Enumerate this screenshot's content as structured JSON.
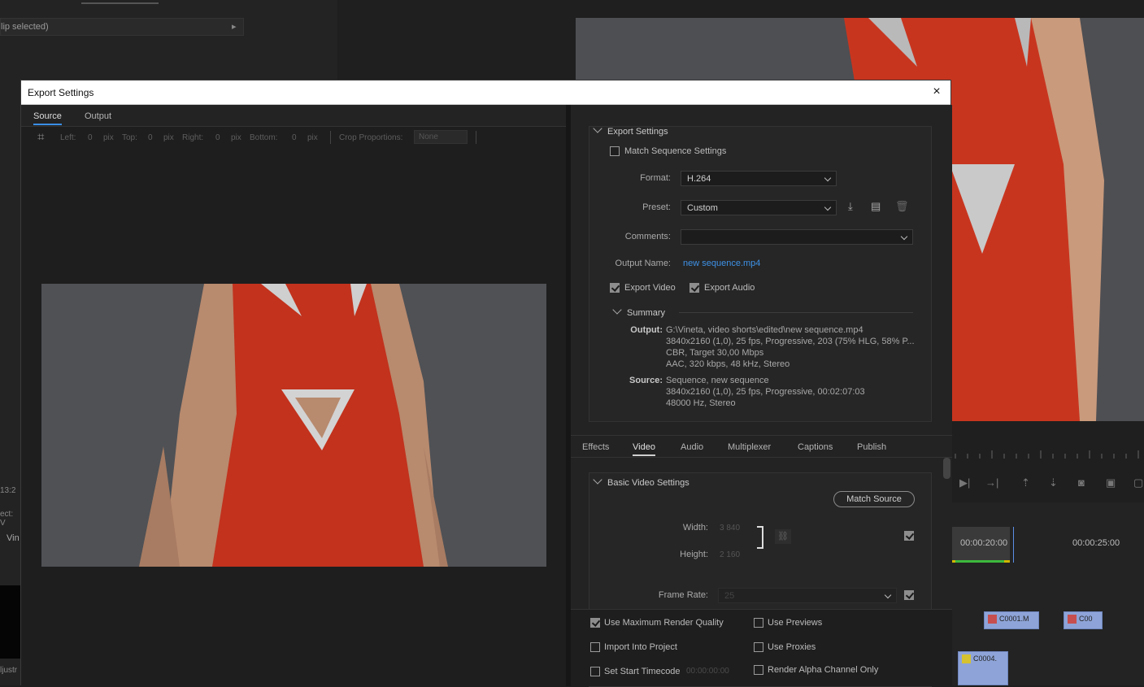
{
  "background": {
    "left_panel_text": "lip selected)",
    "left_snips": [
      "13:2",
      "ect: V",
      "Vin",
      "ljustr"
    ],
    "timecode_a": "00:00:20:00",
    "timecode_b": "00:00:25:00",
    "clips": [
      "C0001.M",
      "C00",
      "C0004."
    ]
  },
  "dialog": {
    "title": "Export Settings",
    "close_icon": "×",
    "source_tabs": [
      "Source",
      "Output"
    ],
    "crop": {
      "left_label": "Left:",
      "left_value": "0",
      "top_label": "Top:",
      "top_value": "0",
      "right_label": "Right:",
      "right_value": "0",
      "bottom_label": "Bottom:",
      "bottom_value": "0",
      "unit": "pix",
      "proportions_label": "Crop Proportions:",
      "proportions_value": "None"
    }
  },
  "export_settings": {
    "header": "Export Settings",
    "match_sequence": "Match Sequence Settings",
    "format_label": "Format:",
    "format_value": "H.264",
    "preset_label": "Preset:",
    "preset_value": "Custom",
    "comments_label": "Comments:",
    "comments_value": "",
    "output_name_label": "Output Name:",
    "output_name_value": "new sequence.mp4",
    "export_video": "Export Video",
    "export_audio": "Export Audio",
    "summary_header": "Summary",
    "output_label": "Output:",
    "output_lines": [
      "G:\\Vineta, video shorts\\edited\\new sequence.mp4",
      "3840x2160 (1,0), 25 fps, Progressive, 203 (75% HLG, 58% P...",
      "CBR, Target 30,00 Mbps",
      "AAC, 320 kbps, 48 kHz, Stereo"
    ],
    "source_label": "Source:",
    "source_lines": [
      "Sequence, new sequence",
      "3840x2160 (1,0), 25 fps, Progressive, 00:02:07:03",
      "48000 Hz, Stereo"
    ]
  },
  "video_tabs": [
    "Effects",
    "Video",
    "Audio",
    "Multiplexer",
    "Captions",
    "Publish"
  ],
  "basic_video": {
    "header": "Basic Video Settings",
    "match_source": "Match Source",
    "width_label": "Width:",
    "width_value": "3 840",
    "height_label": "Height:",
    "height_value": "2 160",
    "frame_rate_label": "Frame Rate:",
    "frame_rate_value": "25"
  },
  "footer": {
    "max_render": "Use Maximum Render Quality",
    "use_previews": "Use Previews",
    "import_project": "Import Into Project",
    "use_proxies": "Use Proxies",
    "set_start_tc": "Set Start Timecode",
    "start_tc_value": "00:00:00:00",
    "render_alpha": "Render Alpha Channel Only"
  }
}
